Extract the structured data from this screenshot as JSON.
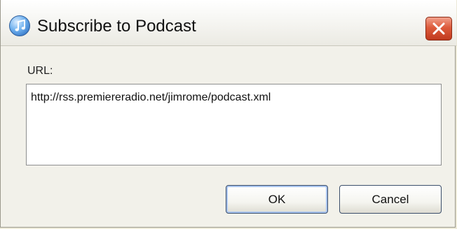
{
  "window": {
    "title": "Subscribe to Podcast",
    "app_icon": "itunes-note-icon",
    "close_icon": "close-icon"
  },
  "form": {
    "url_label": "URL:",
    "url_value": "http://rss.premiereradio.net/jimrome/podcast.xml"
  },
  "buttons": {
    "ok_label": "OK",
    "cancel_label": "Cancel"
  },
  "colors": {
    "close_button": "#dd5b3c",
    "dialog_background": "#f2f1ea",
    "focus_ring": "#a9c4ef"
  }
}
